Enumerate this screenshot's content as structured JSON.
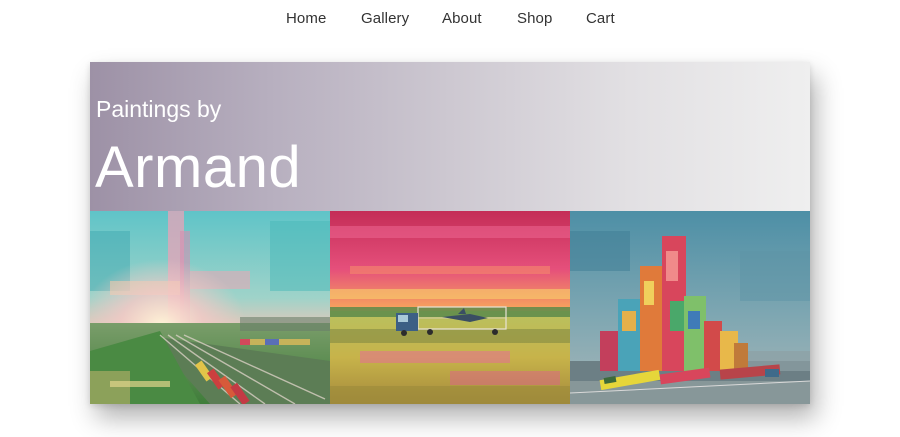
{
  "nav": {
    "items": [
      {
        "label": "Home"
      },
      {
        "label": "Gallery"
      },
      {
        "label": "About"
      },
      {
        "label": "Shop"
      },
      {
        "label": "Cart"
      }
    ]
  },
  "hero": {
    "subtitle": "Paintings by",
    "title": "Armand"
  },
  "paintings": [
    {
      "subject": "rail yard with bright sunrise over teal sky",
      "icon": "painting-rail-yard"
    },
    {
      "subject": "truck on highway under pink sunset sky",
      "icon": "painting-truck-sunset"
    },
    {
      "subject": "colorful stacked container towers by a rail line",
      "icon": "painting-container-towers"
    }
  ],
  "colors": {
    "banner_start": "#9d91a6",
    "banner_end": "#efefef",
    "nav_text": "#333333",
    "hero_text": "#ffffff"
  }
}
